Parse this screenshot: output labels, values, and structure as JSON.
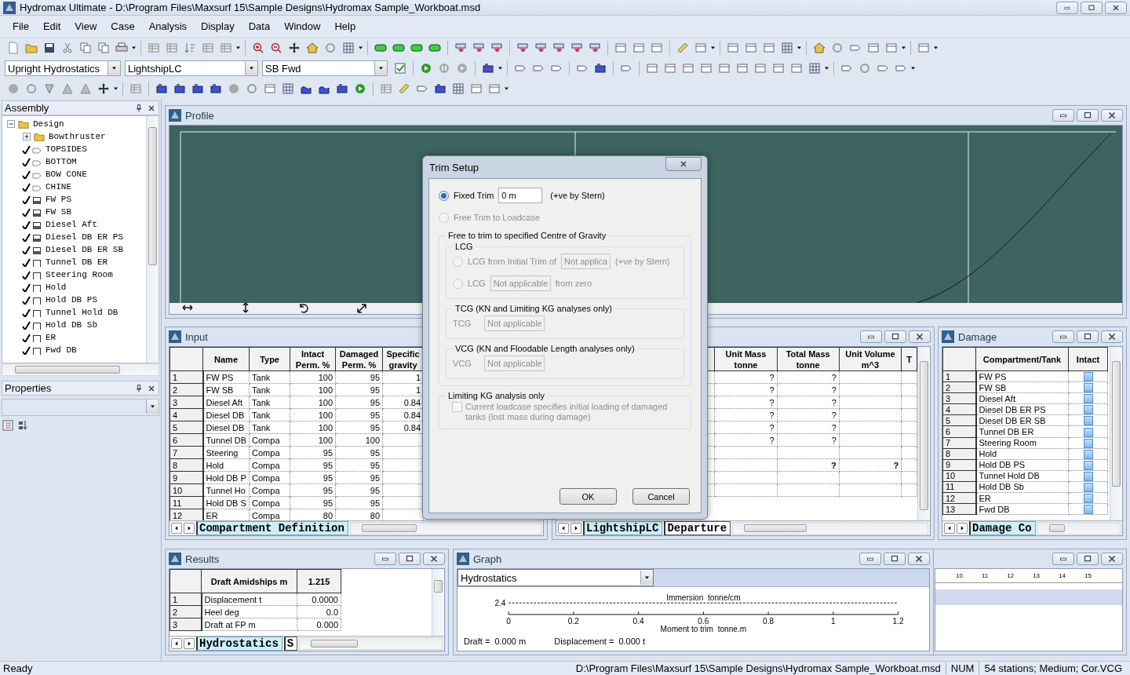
{
  "window": {
    "title": "Hydromax Ultimate - D:\\Program Files\\Maxsurf 15\\Sample Designs\\Hydromax Sample_Workboat.msd"
  },
  "menu": [
    "File",
    "Edit",
    "View",
    "Case",
    "Analysis",
    "Display",
    "Data",
    "Window",
    "Help"
  ],
  "toolbar_selects": [
    {
      "value": "Upright Hydrostatics"
    },
    {
      "value": "LightshipLC"
    },
    {
      "value": "SB Fwd"
    }
  ],
  "assembly": {
    "title": "Assembly",
    "tree": [
      {
        "label": "Design",
        "kind": "folder",
        "expanded": true,
        "children": [
          {
            "label": "Bowthruster",
            "kind": "folder",
            "expanded": false
          },
          {
            "label": "TOPSIDES",
            "kind": "surface",
            "checked": true
          },
          {
            "label": "BOTTOM",
            "kind": "surface",
            "checked": true
          },
          {
            "label": "BOW CONE",
            "kind": "surface",
            "checked": true
          },
          {
            "label": "CHINE",
            "kind": "surface",
            "checked": true
          },
          {
            "label": "FW PS",
            "kind": "tank",
            "checked": true
          },
          {
            "label": "FW SB",
            "kind": "tank",
            "checked": true
          },
          {
            "label": "Diesel Aft",
            "kind": "tank",
            "checked": true
          },
          {
            "label": "Diesel DB ER PS",
            "kind": "tank",
            "checked": true
          },
          {
            "label": "Diesel DB ER SB",
            "kind": "tank",
            "checked": true
          },
          {
            "label": "Tunnel DB ER",
            "kind": "compartment",
            "checked": true
          },
          {
            "label": "Steering Room",
            "kind": "compartment",
            "checked": true
          },
          {
            "label": "Hold",
            "kind": "compartment",
            "checked": true
          },
          {
            "label": "Hold DB PS",
            "kind": "compartment",
            "checked": true
          },
          {
            "label": "Tunnel Hold DB",
            "kind": "compartment",
            "checked": true
          },
          {
            "label": "Hold DB Sb",
            "kind": "compartment",
            "checked": true
          },
          {
            "label": "ER",
            "kind": "compartment",
            "checked": true
          },
          {
            "label": "Fwd DB",
            "kind": "compartment",
            "checked": true
          }
        ]
      }
    ]
  },
  "properties": {
    "title": "Properties"
  },
  "profile": {
    "title": "Profile"
  },
  "input": {
    "title": "Input",
    "columns": [
      "",
      "Name",
      "Type",
      "Intact Perm. %",
      "Damaged Perm. %",
      "Specific gravity"
    ],
    "rows": [
      [
        "1",
        "FW PS",
        "Tank",
        "100",
        "95",
        "1"
      ],
      [
        "2",
        "FW SB",
        "Tank",
        "100",
        "95",
        "1"
      ],
      [
        "3",
        "Diesel Aft",
        "Tank",
        "100",
        "95",
        "0.84"
      ],
      [
        "4",
        "Diesel DB",
        "Tank",
        "100",
        "95",
        "0.84"
      ],
      [
        "5",
        "Diesel DB",
        "Tank",
        "100",
        "95",
        "0.84"
      ],
      [
        "6",
        "Tunnel DB",
        "Compa",
        "100",
        "100",
        ""
      ],
      [
        "7",
        "Steering",
        "Compa",
        "95",
        "95",
        ""
      ],
      [
        "8",
        "Hold",
        "Compa",
        "95",
        "95",
        ""
      ],
      [
        "9",
        "Hold DB P",
        "Compa",
        "95",
        "95",
        ""
      ],
      [
        "10",
        "Tunnel Ho",
        "Compa",
        "95",
        "95",
        ""
      ],
      [
        "11",
        "Hold DB S",
        "Compa",
        "95",
        "95",
        ""
      ],
      [
        "12",
        "ER",
        "Compa",
        "80",
        "80",
        ""
      ]
    ],
    "tabs": [
      {
        "label": "Compartment Definition",
        "selected": true
      }
    ]
  },
  "loadcase": {
    "columns": [
      "Unit Mass tonne",
      "Total Mass tonne",
      "Unit Volume m^3",
      "T"
    ],
    "rows": [
      [
        {
          "text": "?"
        },
        {
          "text": "?"
        },
        {
          "text": ""
        }
      ],
      [
        {
          "text": "?"
        },
        {
          "text": "?"
        },
        {
          "text": ""
        }
      ],
      [
        {
          "text": "?"
        },
        {
          "text": "?"
        },
        {
          "text": ""
        }
      ],
      [
        {
          "text": "?"
        },
        {
          "text": "?"
        },
        {
          "text": ""
        }
      ],
      [
        {
          "text": "?"
        },
        {
          "text": "?"
        },
        {
          "text": ""
        }
      ],
      [
        {
          "text": "?"
        },
        {
          "text": "?"
        },
        {
          "text": ""
        }
      ],
      [
        {
          "text": ""
        },
        {
          "text": ""
        },
        {
          "text": ""
        }
      ],
      [
        {
          "text": ""
        },
        {
          "text": "?",
          "bold": true
        },
        {
          "text": "?",
          "bold": true
        }
      ],
      [
        {
          "text": ""
        },
        {
          "text": ""
        },
        {
          "text": ""
        }
      ],
      [
        {
          "text": ""
        },
        {
          "text": ""
        },
        {
          "text": ""
        }
      ]
    ],
    "tabs": [
      {
        "label": "LightshipLC",
        "selected": true
      },
      {
        "label": "Departure",
        "selected": false
      }
    ]
  },
  "damage": {
    "title": "Damage",
    "columns": [
      "Compartment/Tank",
      "Intact"
    ],
    "rows": [
      {
        "index": "1",
        "name": "FW PS",
        "intact": false
      },
      {
        "index": "2",
        "name": "FW SB",
        "intact": false
      },
      {
        "index": "3",
        "name": "Diesel Aft",
        "intact": false
      },
      {
        "index": "4",
        "name": "Diesel DB ER PS",
        "intact": false
      },
      {
        "index": "5",
        "name": "Diesel DB ER SB",
        "intact": false
      },
      {
        "index": "6",
        "name": "Tunnel DB ER",
        "intact": false
      },
      {
        "index": "7",
        "name": "Steering Room",
        "intact": false
      },
      {
        "index": "8",
        "name": "Hold",
        "intact": false
      },
      {
        "index": "9",
        "name": "Hold DB PS",
        "intact": false
      },
      {
        "index": "10",
        "name": "Tunnel Hold DB",
        "intact": false
      },
      {
        "index": "11",
        "name": "Hold DB Sb",
        "intact": false
      },
      {
        "index": "12",
        "name": "ER",
        "intact": false
      },
      {
        "index": "13",
        "name": "Fwd DB",
        "intact": false
      }
    ],
    "tabs": [
      {
        "label": "Damage Co",
        "selected": true
      }
    ]
  },
  "results": {
    "title": "Results",
    "columns": [
      "",
      "Draft Amidships m",
      "1.215"
    ],
    "rows": [
      [
        "1",
        "Displacement t",
        "0.0000"
      ],
      [
        "2",
        "Heel deg",
        "0.0"
      ],
      [
        "3",
        "Draft at FP m",
        "0.000"
      ]
    ],
    "tabs": [
      {
        "label": "Hydrostatics",
        "selected": true
      },
      {
        "label": "S",
        "selected": false
      }
    ]
  },
  "graph": {
    "title": "Graph",
    "select": "Hydrostatics",
    "plot": {
      "x_labels": [
        "0",
        "0.2",
        "0.4",
        "0.6",
        "0.8",
        "1",
        "1.2"
      ],
      "x_title": "Moment to trim  tonne.m",
      "y_label": "2.4",
      "curve_label": "Immersion  tonne/cm"
    },
    "readouts": [
      "Draft =  0.000 m",
      "Displacement =  0.000 t"
    ]
  },
  "ruler": {
    "labels": [
      "10",
      "11",
      "12",
      "13",
      "14",
      "15"
    ]
  },
  "dialog": {
    "title": "Trim Setup",
    "options": [
      {
        "label": "Fixed Trim",
        "selected": true,
        "disabled": false,
        "value": "0 m",
        "note": "(+ve by Stern)"
      },
      {
        "label": "Free Trim to Loadcase",
        "selected": false,
        "disabled": true
      }
    ],
    "cg_group": {
      "legend": "Free to trim to specified Centre of Gravity",
      "groups": [
        {
          "kind": "radios",
          "legend": "LCG",
          "options": [
            {
              "label": "LCG from Initial Trim of",
              "selected": false,
              "disabled": true,
              "value": "Not applica",
              "note": "(+ve by Stern)"
            },
            {
              "label": "LCG",
              "selected": false,
              "disabled": true,
              "value": "Not applicable",
              "note": "from zero"
            }
          ]
        },
        {
          "kind": "field",
          "legend": "TCG (KN and Limiting KG analyses only)",
          "label": "TCG",
          "value": "Not applicable",
          "disabled": true
        },
        {
          "kind": "field",
          "legend": "VCG (KN and Floodable Length analyses only)",
          "label": "VCG",
          "value": "Not applicable",
          "disabled": true
        }
      ]
    },
    "kg_group": {
      "legend": "Limiting KG analysis only",
      "checkbox": {
        "label": "Current loadcase specifies initial loading of damaged tanks (lost mass during damage)",
        "checked": false,
        "disabled": true
      }
    },
    "buttons": [
      "OK",
      "Cancel"
    ]
  },
  "status_bar": {
    "left": "Ready",
    "path": "D:\\Program Files\\Maxsurf 15\\Sample Designs\\Hydromax Sample_Workboat.msd",
    "mode": "NUM",
    "info": "54 stations; Medium; Cor.VCG"
  }
}
